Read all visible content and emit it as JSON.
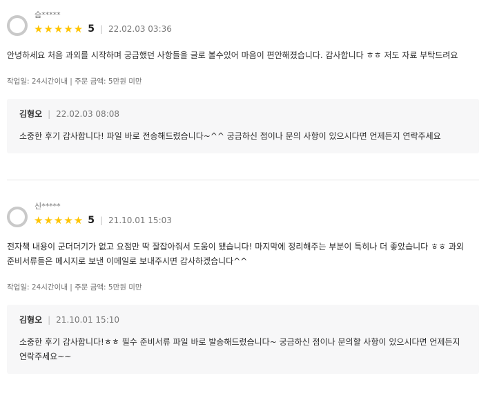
{
  "colors": {
    "star": "#ffc400",
    "reply_background": "#f7f7f8",
    "separator": "#e4e4e4"
  },
  "reviews": [
    {
      "reviewer": "슴*****",
      "stars": "★★★★★",
      "rating": "5",
      "divider": "|",
      "date": "22.02.03 03:36",
      "content": "안녕하세요 처음 과외를 시작하며 궁금했던 사항들을 글로 볼수있어 마음이 편안해졌습니다. 감사합니다 ㅎㅎ 저도 자료 부탁드려요",
      "work_info": "작업일: 24시간이내 | 주문 금액: 5만원 미만",
      "reply": {
        "author": "김형오",
        "divider": "|",
        "date": "22.02.03 08:08",
        "text": "소중한 후기 감사합니다! 파일 바로 전송해드렸습니다~^^ 궁금하신 점이나 문의 사항이 있으시다면 언제든지 연락주세요"
      }
    },
    {
      "reviewer": "신*****",
      "stars": "★★★★★",
      "rating": "5",
      "divider": "|",
      "date": "21.10.01 15:03",
      "content": "전자책 내용이 군더더기가 없고 요점만 딱 잘잡아줘서 도움이 됐습니다! 마지막에 정리해주는 부분이 특히나 더 좋았습니다 ㅎㅎ 과외 준비서류들은 메시지로 보낸 이메일로 보내주시면 감사하겠습니다^^",
      "work_info": "작업일: 24시간이내 | 주문 금액: 5만원 미만",
      "reply": {
        "author": "김형오",
        "divider": "|",
        "date": "21.10.01 15:10",
        "text": "소중한 후기 감사합니다!ㅎㅎ 필수 준비서류 파일 바로 발송해드렸습니다~ 궁금하신 점이나 문의할 사항이 있으시다면 언제든지 연락주세요~~"
      }
    }
  ]
}
